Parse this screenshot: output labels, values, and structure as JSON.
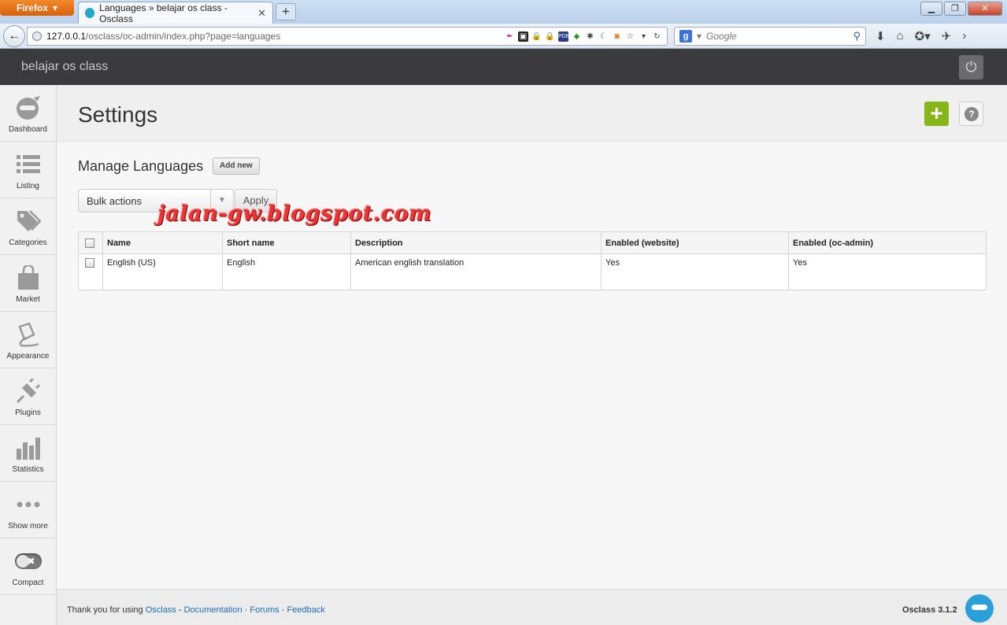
{
  "browser": {
    "menu_button": "Firefox",
    "tab_title": "Languages » belajar os class - Osclass",
    "new_tab": "+",
    "url_host": "127.0.0.1",
    "url_path": "/osclass/oc-admin/index.php?page=languages",
    "search_engine": "Google",
    "search_placeholder": "Google"
  },
  "header": {
    "site_title": "belajar os class"
  },
  "sidebar": {
    "items": [
      {
        "label": "Dashboard",
        "icon": "dashboard-icon"
      },
      {
        "label": "Listing",
        "icon": "listing-icon"
      },
      {
        "label": "Categories",
        "icon": "categories-icon"
      },
      {
        "label": "Market",
        "icon": "market-icon"
      },
      {
        "label": "Appearance",
        "icon": "appearance-icon"
      },
      {
        "label": "Plugins",
        "icon": "plugins-icon"
      },
      {
        "label": "Statistics",
        "icon": "statistics-icon"
      },
      {
        "label": "Show more",
        "icon": "more-icon"
      },
      {
        "label": "Compact",
        "icon": "compact-toggle-icon"
      }
    ]
  },
  "page": {
    "title": "Settings",
    "section_title": "Manage Languages",
    "add_new_label": "Add new",
    "bulk_actions_label": "Bulk actions",
    "apply_label": "Apply"
  },
  "table": {
    "columns": [
      "Name",
      "Short name",
      "Description",
      "Enabled (website)",
      "Enabled (oc-admin)"
    ],
    "rows": [
      {
        "name": "English (US)",
        "short_name": "English",
        "description": "American english translation",
        "enabled_website": "Yes",
        "enabled_admin": "Yes"
      }
    ]
  },
  "watermark": "jalan-gw.blogspot.com",
  "footer": {
    "thanks": "Thank you for using",
    "link_osclass": "Osclass",
    "link_documentation": "Documentation",
    "link_forums": "Forums",
    "link_feedback": "Feedback",
    "version": "Osclass 3.1.2"
  },
  "colors": {
    "accent_green": "#88b517",
    "admin_bar": "#3b3b3e",
    "link_blue": "#1c6db5",
    "brand_blue": "#2b9fd8"
  }
}
